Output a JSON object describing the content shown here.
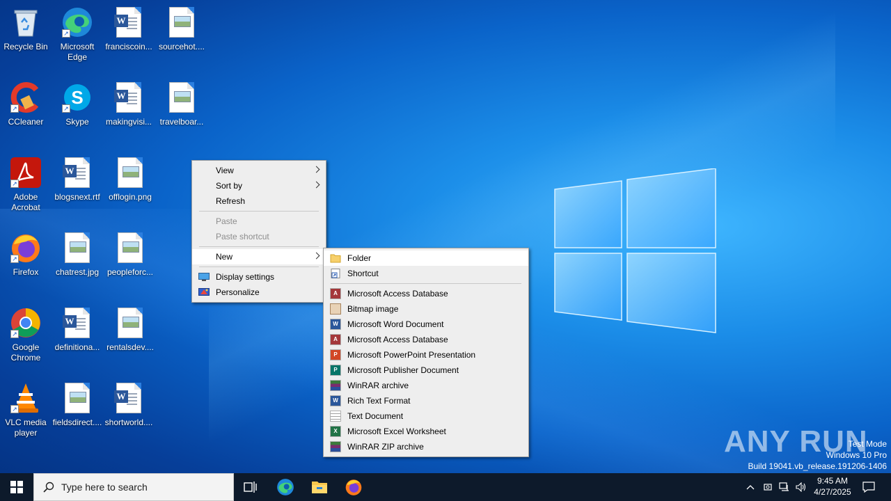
{
  "desktop_icons": [
    {
      "label": "Recycle Bin",
      "icon": "recycle-bin-icon"
    },
    {
      "label": "Microsoft Edge",
      "icon": "edge-icon"
    },
    {
      "label": "franciscoin...",
      "icon": "word-doc-icon"
    },
    {
      "label": "sourcehot....",
      "icon": "image-file-icon"
    },
    {
      "label": "CCleaner",
      "icon": "ccleaner-icon"
    },
    {
      "label": "Skype",
      "icon": "skype-icon"
    },
    {
      "label": "makingvisi...",
      "icon": "word-doc-icon"
    },
    {
      "label": "travelboar...",
      "icon": "image-file-icon"
    },
    {
      "label": "Adobe Acrobat",
      "icon": "acrobat-icon"
    },
    {
      "label": "blogsnext.rtf",
      "icon": "word-doc-icon"
    },
    {
      "label": "offlogin.png",
      "icon": "image-file-icon"
    },
    {
      "label": "Firefox",
      "icon": "firefox-icon"
    },
    {
      "label": "chatrest.jpg",
      "icon": "image-file-icon"
    },
    {
      "label": "peopleforc...",
      "icon": "image-file-icon"
    },
    {
      "label": "Google Chrome",
      "icon": "chrome-icon"
    },
    {
      "label": "definitiona...",
      "icon": "word-doc-icon"
    },
    {
      "label": "rentalsdev....",
      "icon": "image-file-icon"
    },
    {
      "label": "VLC media player",
      "icon": "vlc-icon"
    },
    {
      "label": "fieldsdirect....",
      "icon": "image-file-icon"
    },
    {
      "label": "shortworld....",
      "icon": "word-doc-icon"
    }
  ],
  "context_menu": {
    "view": "View",
    "sort_by": "Sort by",
    "refresh": "Refresh",
    "paste": "Paste",
    "paste_shortcut": "Paste shortcut",
    "new": "New",
    "display_settings": "Display settings",
    "personalize": "Personalize"
  },
  "new_submenu": {
    "folder": "Folder",
    "shortcut": "Shortcut",
    "items": [
      {
        "label": "Microsoft Access Database",
        "icon": "access-icon",
        "color": "#a4373a"
      },
      {
        "label": "Bitmap image",
        "icon": "bitmap-icon",
        "color": "#c8843c"
      },
      {
        "label": "Microsoft Word Document",
        "icon": "word-icon",
        "color": "#2b579a"
      },
      {
        "label": "Microsoft Access Database",
        "icon": "access-icon",
        "color": "#a4373a"
      },
      {
        "label": "Microsoft PowerPoint Presentation",
        "icon": "powerpoint-icon",
        "color": "#d24726"
      },
      {
        "label": "Microsoft Publisher Document",
        "icon": "publisher-icon",
        "color": "#077568"
      },
      {
        "label": "WinRAR archive",
        "icon": "winrar-icon",
        "color": "#7a2b6e"
      },
      {
        "label": "Rich Text Format",
        "icon": "rtf-icon",
        "color": "#2b579a"
      },
      {
        "label": "Text Document",
        "icon": "text-doc-icon",
        "color": "#9a9a9a"
      },
      {
        "label": "Microsoft Excel Worksheet",
        "icon": "excel-icon",
        "color": "#217346"
      },
      {
        "label": "WinRAR ZIP archive",
        "icon": "winrar-zip-icon",
        "color": "#7a2b6e"
      }
    ]
  },
  "taskbar": {
    "search_placeholder": "Type here to search",
    "time": "9:45 AM",
    "date": "4/27/2025"
  },
  "watermark": {
    "line1": "Test Mode",
    "line2": "Windows 10 Pro",
    "line3": "Build 19041.vb_release.191206-1406",
    "brand": "ANY RUN"
  }
}
